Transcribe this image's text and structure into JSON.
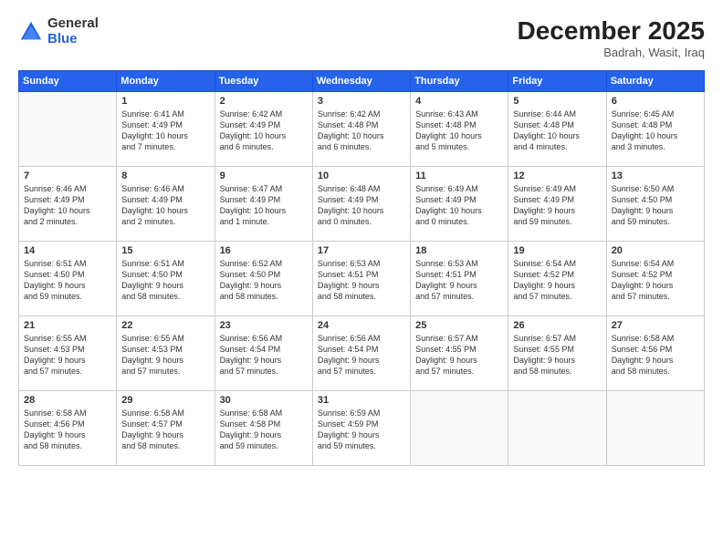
{
  "logo": {
    "general": "General",
    "blue": "Blue"
  },
  "header": {
    "month": "December 2025",
    "location": "Badrah, Wasit, Iraq"
  },
  "weekdays": [
    "Sunday",
    "Monday",
    "Tuesday",
    "Wednesday",
    "Thursday",
    "Friday",
    "Saturday"
  ],
  "weeks": [
    [
      {
        "day": "",
        "info": ""
      },
      {
        "day": "1",
        "info": "Sunrise: 6:41 AM\nSunset: 4:49 PM\nDaylight: 10 hours\nand 7 minutes."
      },
      {
        "day": "2",
        "info": "Sunrise: 6:42 AM\nSunset: 4:49 PM\nDaylight: 10 hours\nand 6 minutes."
      },
      {
        "day": "3",
        "info": "Sunrise: 6:42 AM\nSunset: 4:48 PM\nDaylight: 10 hours\nand 6 minutes."
      },
      {
        "day": "4",
        "info": "Sunrise: 6:43 AM\nSunset: 4:48 PM\nDaylight: 10 hours\nand 5 minutes."
      },
      {
        "day": "5",
        "info": "Sunrise: 6:44 AM\nSunset: 4:48 PM\nDaylight: 10 hours\nand 4 minutes."
      },
      {
        "day": "6",
        "info": "Sunrise: 6:45 AM\nSunset: 4:48 PM\nDaylight: 10 hours\nand 3 minutes."
      }
    ],
    [
      {
        "day": "7",
        "info": "Sunrise: 6:46 AM\nSunset: 4:49 PM\nDaylight: 10 hours\nand 2 minutes."
      },
      {
        "day": "8",
        "info": "Sunrise: 6:46 AM\nSunset: 4:49 PM\nDaylight: 10 hours\nand 2 minutes."
      },
      {
        "day": "9",
        "info": "Sunrise: 6:47 AM\nSunset: 4:49 PM\nDaylight: 10 hours\nand 1 minute."
      },
      {
        "day": "10",
        "info": "Sunrise: 6:48 AM\nSunset: 4:49 PM\nDaylight: 10 hours\nand 0 minutes."
      },
      {
        "day": "11",
        "info": "Sunrise: 6:49 AM\nSunset: 4:49 PM\nDaylight: 10 hours\nand 0 minutes."
      },
      {
        "day": "12",
        "info": "Sunrise: 6:49 AM\nSunset: 4:49 PM\nDaylight: 9 hours\nand 59 minutes."
      },
      {
        "day": "13",
        "info": "Sunrise: 6:50 AM\nSunset: 4:50 PM\nDaylight: 9 hours\nand 59 minutes."
      }
    ],
    [
      {
        "day": "14",
        "info": "Sunrise: 6:51 AM\nSunset: 4:50 PM\nDaylight: 9 hours\nand 59 minutes."
      },
      {
        "day": "15",
        "info": "Sunrise: 6:51 AM\nSunset: 4:50 PM\nDaylight: 9 hours\nand 58 minutes."
      },
      {
        "day": "16",
        "info": "Sunrise: 6:52 AM\nSunset: 4:50 PM\nDaylight: 9 hours\nand 58 minutes."
      },
      {
        "day": "17",
        "info": "Sunrise: 6:53 AM\nSunset: 4:51 PM\nDaylight: 9 hours\nand 58 minutes."
      },
      {
        "day": "18",
        "info": "Sunrise: 6:53 AM\nSunset: 4:51 PM\nDaylight: 9 hours\nand 57 minutes."
      },
      {
        "day": "19",
        "info": "Sunrise: 6:54 AM\nSunset: 4:52 PM\nDaylight: 9 hours\nand 57 minutes."
      },
      {
        "day": "20",
        "info": "Sunrise: 6:54 AM\nSunset: 4:52 PM\nDaylight: 9 hours\nand 57 minutes."
      }
    ],
    [
      {
        "day": "21",
        "info": "Sunrise: 6:55 AM\nSunset: 4:53 PM\nDaylight: 9 hours\nand 57 minutes."
      },
      {
        "day": "22",
        "info": "Sunrise: 6:55 AM\nSunset: 4:53 PM\nDaylight: 9 hours\nand 57 minutes."
      },
      {
        "day": "23",
        "info": "Sunrise: 6:56 AM\nSunset: 4:54 PM\nDaylight: 9 hours\nand 57 minutes."
      },
      {
        "day": "24",
        "info": "Sunrise: 6:56 AM\nSunset: 4:54 PM\nDaylight: 9 hours\nand 57 minutes."
      },
      {
        "day": "25",
        "info": "Sunrise: 6:57 AM\nSunset: 4:55 PM\nDaylight: 9 hours\nand 57 minutes."
      },
      {
        "day": "26",
        "info": "Sunrise: 6:57 AM\nSunset: 4:55 PM\nDaylight: 9 hours\nand 58 minutes."
      },
      {
        "day": "27",
        "info": "Sunrise: 6:58 AM\nSunset: 4:56 PM\nDaylight: 9 hours\nand 58 minutes."
      }
    ],
    [
      {
        "day": "28",
        "info": "Sunrise: 6:58 AM\nSunset: 4:56 PM\nDaylight: 9 hours\nand 58 minutes."
      },
      {
        "day": "29",
        "info": "Sunrise: 6:58 AM\nSunset: 4:57 PM\nDaylight: 9 hours\nand 58 minutes."
      },
      {
        "day": "30",
        "info": "Sunrise: 6:58 AM\nSunset: 4:58 PM\nDaylight: 9 hours\nand 59 minutes."
      },
      {
        "day": "31",
        "info": "Sunrise: 6:59 AM\nSunset: 4:59 PM\nDaylight: 9 hours\nand 59 minutes."
      },
      {
        "day": "",
        "info": ""
      },
      {
        "day": "",
        "info": ""
      },
      {
        "day": "",
        "info": ""
      }
    ]
  ]
}
